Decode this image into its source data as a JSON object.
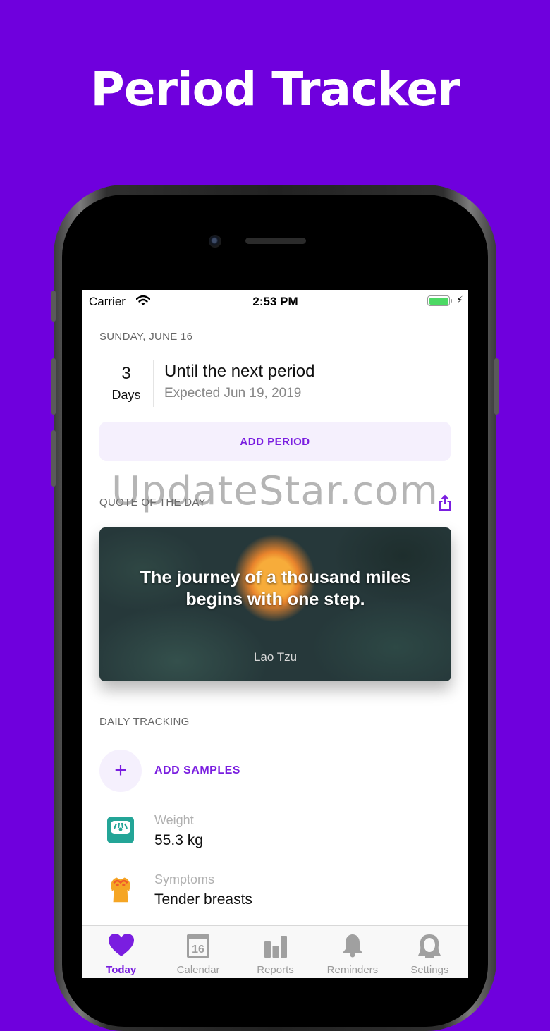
{
  "headline": "Period Tracker",
  "status": {
    "carrier": "Carrier",
    "time": "2:53 PM"
  },
  "date_label": "SUNDAY, JUNE 16",
  "countdown": {
    "number": "3",
    "unit": "Days",
    "title": "Until the next period",
    "expected": "Expected Jun 19, 2019"
  },
  "add_period_label": "ADD PERIOD",
  "quote_section_label": "QUOTE OF THE DAY",
  "quote": {
    "text_line1": "The journey of a thousand miles",
    "text_line2": "begins with one step.",
    "author": "Lao Tzu"
  },
  "daily_tracking_label": "DAILY TRACKING",
  "add_samples_label": "ADD SAMPLES",
  "tracking_rows": [
    {
      "label": "Weight",
      "value": "55.3 kg",
      "icon": "scale-icon"
    },
    {
      "label": "Symptoms",
      "value": "Tender breasts",
      "icon": "body-icon"
    }
  ],
  "tabs": [
    {
      "label": "Today",
      "icon": "heart-icon",
      "active": true
    },
    {
      "label": "Calendar",
      "icon": "calendar-icon",
      "calendar_day": "16"
    },
    {
      "label": "Reports",
      "icon": "bar-chart-icon"
    },
    {
      "label": "Reminders",
      "icon": "bell-icon"
    },
    {
      "label": "Settings",
      "icon": "person-icon"
    }
  ],
  "watermark": "UpdateStar.com",
  "colors": {
    "background": "#6f00dd",
    "accent": "#7a1ee0",
    "battery": "#4cd964"
  }
}
